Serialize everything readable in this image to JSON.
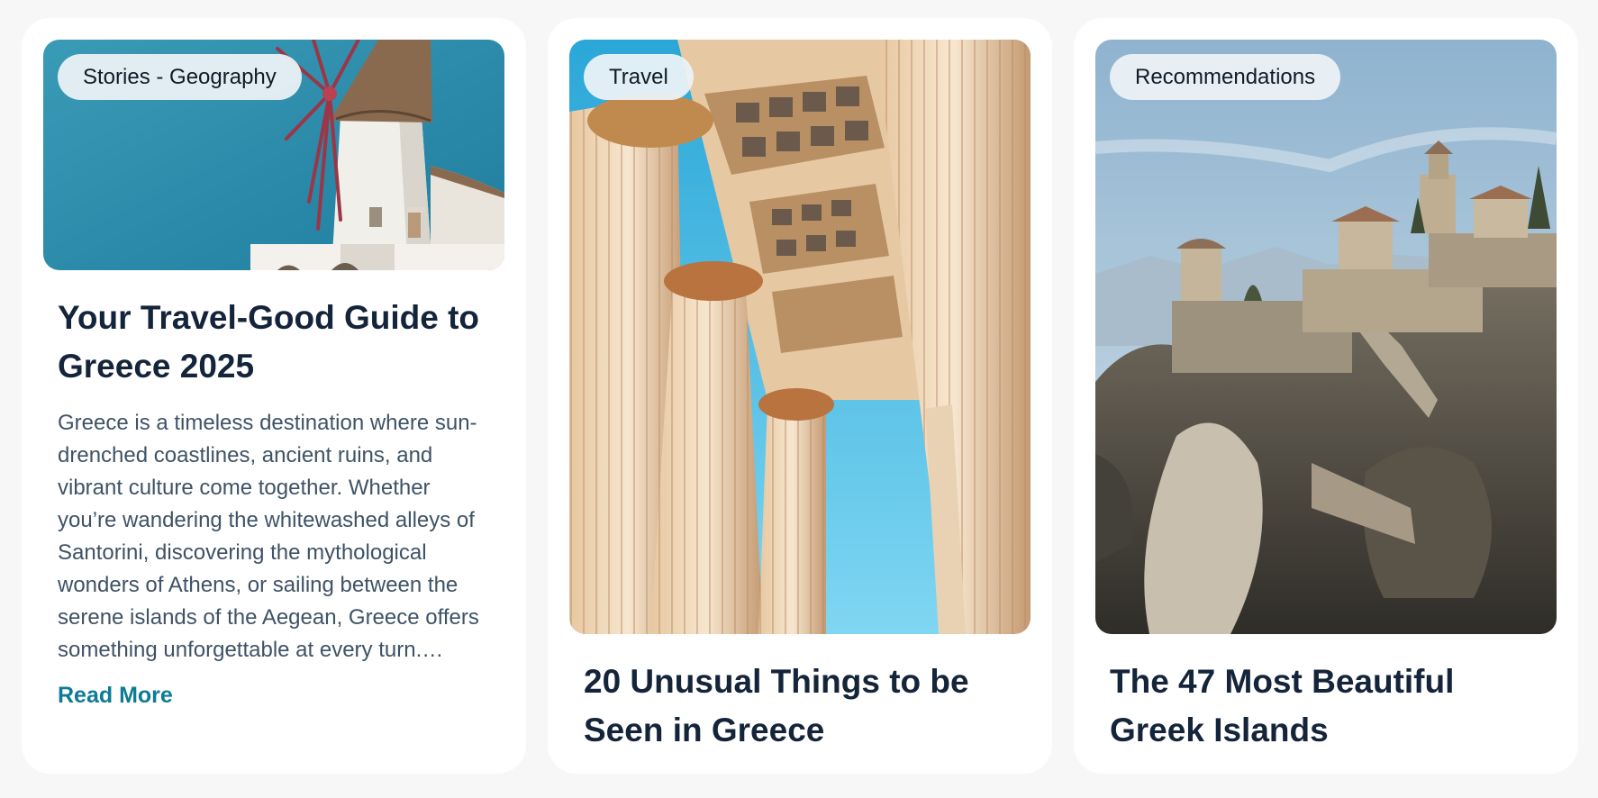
{
  "cards": [
    {
      "tag": "Stories - Geography",
      "title": "Your Travel-Good Guide to Greece 2025",
      "excerpt": "Greece is a timeless destination where sun-drenched coastlines, ancient ruins, and vibrant culture come together. Whether you’re wandering the whitewashed alleys of Santorini, discovering the mythological wonders of Athens, or sailing between the serene islands of the Aegean, Greece offers something unforgettable at every turn.…",
      "read_more": "Read More",
      "image": "santorini-windmill-photo"
    },
    {
      "tag": "Travel",
      "title": "20 Unusual Things to be Seen in Greece",
      "image": "greek-columns-photo"
    },
    {
      "tag": "Recommendations",
      "title": "The 47 Most Beautiful Greek Islands",
      "image": "meteora-monastery-photo"
    }
  ],
  "colors": {
    "page_background": "#f7f7f8",
    "card_background": "#ffffff",
    "title": "#14243a",
    "body_text": "#3f5266",
    "link": "#0d7b96",
    "tag_background": "#ecf2f6"
  }
}
